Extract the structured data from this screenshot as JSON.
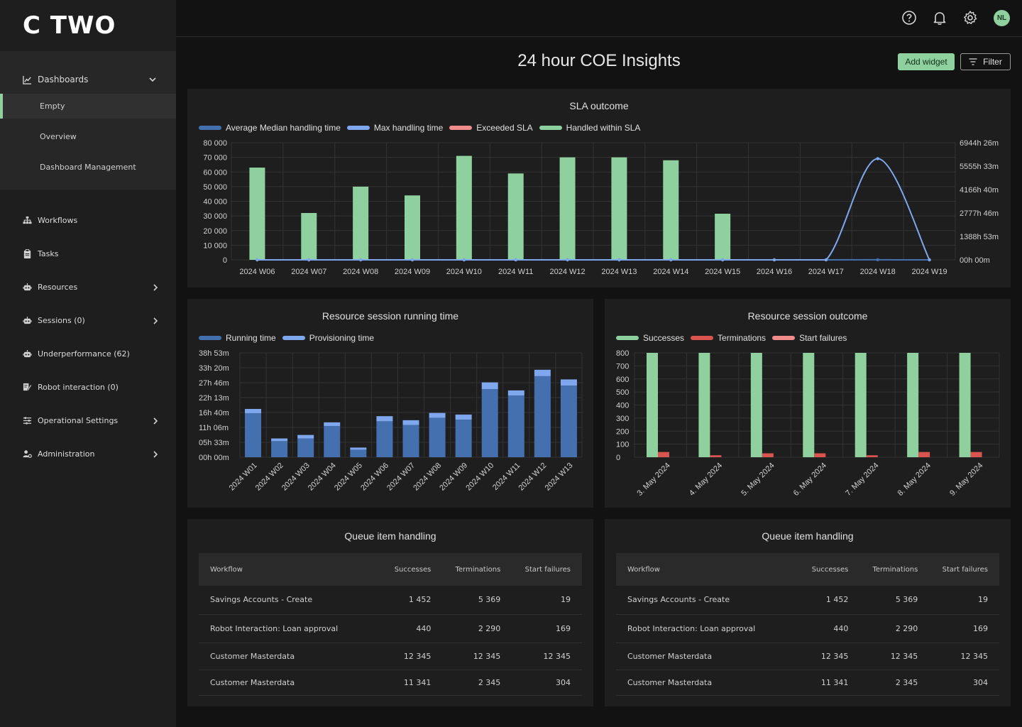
{
  "brand": {
    "name": "C TWO"
  },
  "sidebar": {
    "group": {
      "label": "Dashboards",
      "icon": "line-chart-icon",
      "items": [
        {
          "label": "Empty",
          "active": true
        },
        {
          "label": "Overview"
        },
        {
          "label": "Dashboard Management"
        }
      ]
    },
    "items": [
      {
        "label": "Workflows",
        "icon": "sitemap-icon",
        "has_chevron": false
      },
      {
        "label": "Tasks",
        "icon": "clipboard-icon",
        "has_chevron": false
      },
      {
        "label": "Resources",
        "icon": "robot-icon",
        "has_chevron": true
      },
      {
        "label": "Sessions (0)",
        "icon": "robot-icon",
        "has_chevron": true
      },
      {
        "label": "Underperformance (62)",
        "icon": "robot-icon",
        "has_chevron": false
      },
      {
        "label": "Robot interaction (0)",
        "icon": "signature-icon",
        "has_chevron": false
      },
      {
        "label": "Operational Settings",
        "icon": "sliders-icon",
        "has_chevron": true
      },
      {
        "label": "Administration",
        "icon": "user-gear-icon",
        "has_chevron": true
      }
    ]
  },
  "topbar": {
    "icons": [
      "help-icon",
      "bell-icon",
      "gear-icon"
    ],
    "avatar_initials": "NL"
  },
  "header": {
    "title": "24 hour COE Insights",
    "add_widget_label": "Add widget",
    "filter_label": "Filter"
  },
  "colors": {
    "accent": "#8fd19e",
    "dark_blue": "#4470b0",
    "light_blue": "#7ea7ee",
    "light_red": "#f08c8c",
    "red": "#d9534f"
  },
  "chart_data": [
    {
      "type": "bar",
      "title": "SLA outcome",
      "categories": [
        "2024 W06",
        "2024 W07",
        "2024 W08",
        "2024 W09",
        "2024 W10",
        "2024 W11",
        "2024 W12",
        "2024 W13",
        "2024 W14",
        "2024 W15",
        "2024 W16",
        "2024 W17",
        "2024 W18",
        "2024 W19"
      ],
      "series": [
        {
          "name": "Average Median handling time",
          "type": "line",
          "axis": "right",
          "color": "#4470b0",
          "values": [
            0,
            0,
            0,
            0,
            0,
            0,
            0,
            0,
            0,
            0,
            0,
            0,
            3,
            0
          ]
        },
        {
          "name": "Max handling time",
          "type": "line",
          "axis": "right",
          "color": "#7ea7ee",
          "values": [
            0,
            0,
            0,
            0,
            0,
            0,
            0,
            0,
            0,
            0,
            0,
            0,
            6000,
            0
          ]
        },
        {
          "name": "Exceeded SLA",
          "type": "bar",
          "axis": "left",
          "color": "#f08c8c",
          "values": [
            0,
            0,
            0,
            0,
            0,
            0,
            0,
            0,
            0,
            0,
            0,
            0,
            0,
            0
          ]
        },
        {
          "name": "Handled within SLA",
          "type": "bar",
          "axis": "left",
          "color": "#8fd19e",
          "values": [
            63000,
            32000,
            50000,
            44000,
            71000,
            59000,
            70000,
            70000,
            68000,
            31500,
            0,
            0,
            0,
            0
          ]
        }
      ],
      "y_ticks": [
        "0",
        "10 000",
        "20 000",
        "30 000",
        "40 000",
        "50 000",
        "60 000",
        "70 000",
        "80 000"
      ],
      "ylim": [
        0,
        80000
      ],
      "y2_ticks": [
        "00h 00m",
        "1388h 53m",
        "2777h 46m",
        "4166h 40m",
        "5555h 33m",
        "6944h 26m"
      ],
      "y2lim": [
        0,
        6944.43
      ],
      "grid": true,
      "legend": "top-left"
    },
    {
      "type": "bar",
      "stacked": true,
      "title": "Resource session running time",
      "categories": [
        "2024 W01",
        "2024 W02",
        "2024 W03",
        "2024 W04",
        "2024 W05",
        "2024 W06",
        "2024 W07",
        "2024 W08",
        "2024 W09",
        "2024 W10",
        "2024 W11",
        "2024 W12",
        "2024 W13"
      ],
      "series": [
        {
          "name": "Running time",
          "color": "#4470b0",
          "values": [
            16.4,
            6.0,
            7.0,
            11.6,
            2.8,
            13.4,
            12.0,
            14.7,
            14.0,
            25.4,
            23.0,
            30.2,
            26.7
          ]
        },
        {
          "name": "Provisioning time",
          "color": "#7ea7ee",
          "values": [
            1.6,
            1.0,
            1.3,
            1.4,
            0.8,
            1.9,
            1.8,
            1.8,
            1.9,
            2.5,
            1.9,
            2.4,
            2.3
          ]
        }
      ],
      "y_ticks": [
        "00h 00m",
        "05h 33m",
        "11h 06m",
        "16h 40m",
        "22h 13m",
        "27h 46m",
        "33h 20m",
        "38h 53m"
      ],
      "ylim": [
        0,
        38.9
      ],
      "grid": true,
      "legend": "top-left"
    },
    {
      "type": "bar",
      "title": "Resource session outcome",
      "categories": [
        "3. May 2024",
        "4. May 2024",
        "5. May 2024",
        "6. May 2024",
        "7. May 2024",
        "8. May 2024",
        "9. May 2024"
      ],
      "series": [
        {
          "name": "Successes",
          "color": "#8fd19e",
          "values": [
            800,
            800,
            800,
            800,
            800,
            800,
            800
          ]
        },
        {
          "name": "Terminations",
          "color": "#d9534f",
          "values": [
            40,
            15,
            30,
            30,
            15,
            40,
            40
          ]
        },
        {
          "name": "Start failures",
          "color": "#f08c8c",
          "values": [
            0,
            0,
            0,
            0,
            0,
            0,
            0
          ]
        }
      ],
      "y_ticks": [
        "0",
        "100",
        "200",
        "300",
        "400",
        "500",
        "600",
        "700",
        "800"
      ],
      "ylim": [
        0,
        800
      ],
      "grid": true,
      "legend": "top-left"
    }
  ],
  "tables": [
    {
      "title": "Queue item handling",
      "columns": [
        "Workflow",
        "Successes",
        "Terminations",
        "Start failures"
      ],
      "rows": [
        [
          "Savings Accounts - Create",
          "1 452",
          "5 369",
          "19"
        ],
        [
          "Robot Interaction: Loan approval",
          "440",
          "2 290",
          "169"
        ],
        [
          "Customer Masterdata",
          "12 345",
          "12 345",
          "12 345"
        ],
        [
          "Customer Masterdata",
          "11 341",
          "2 345",
          "304"
        ]
      ]
    },
    {
      "title": "Queue item handling",
      "columns": [
        "Workflow",
        "Successes",
        "Terminations",
        "Start failures"
      ],
      "rows": [
        [
          "Savings Accounts - Create",
          "1 452",
          "5 369",
          "19"
        ],
        [
          "Robot Interaction: Loan approval",
          "440",
          "2 290",
          "169"
        ],
        [
          "Customer Masterdata",
          "12 345",
          "12 345",
          "12 345"
        ],
        [
          "Customer Masterdata",
          "11 341",
          "2 345",
          "304"
        ]
      ]
    }
  ]
}
